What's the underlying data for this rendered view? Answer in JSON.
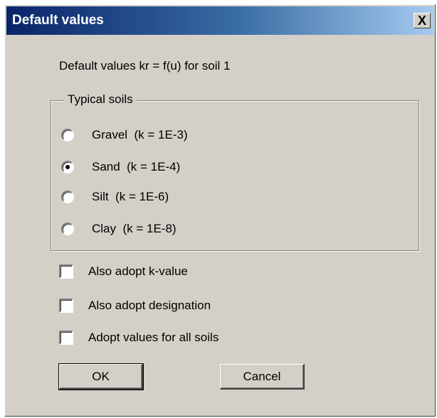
{
  "window": {
    "title": "Default values",
    "close_glyph": "X"
  },
  "subtitle": "Default values kr = f(u) for soil 1",
  "group": {
    "legend": "Typical soils",
    "options": [
      {
        "label": "Gravel  (k = 1E-3)",
        "selected": false
      },
      {
        "label": "Sand  (k = 1E-4)",
        "selected": true
      },
      {
        "label": "Silt  (k = 1E-6)",
        "selected": false
      },
      {
        "label": "Clay  (k = 1E-8)",
        "selected": false
      }
    ]
  },
  "checkboxes": [
    {
      "label": "Also adopt k-value",
      "checked": false
    },
    {
      "label": "Also adopt designation",
      "checked": false
    },
    {
      "label": "Adopt values for all soils",
      "checked": false
    }
  ],
  "buttons": {
    "ok": "OK",
    "cancel": "Cancel"
  }
}
